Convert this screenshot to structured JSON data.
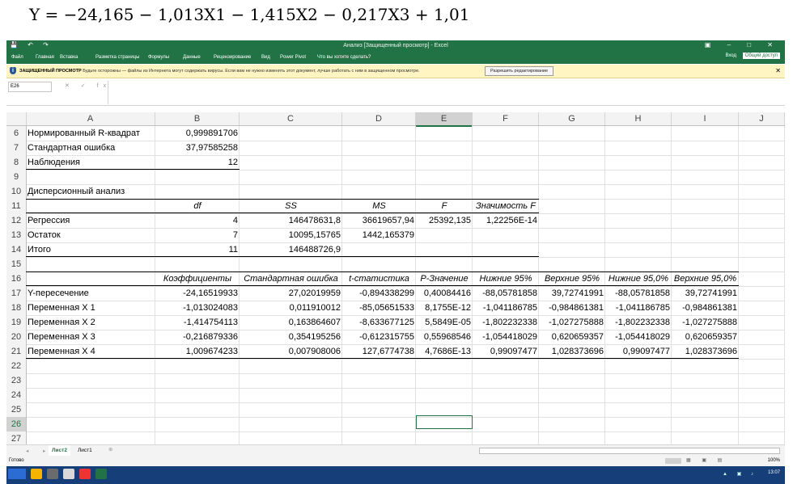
{
  "formula": "Y = −24,165 − 1,013X1 − 1,415X2 − 0,217X3 + 1,01",
  "window": {
    "quick_access": "💾 ↶ ↷",
    "title": "Анализ [Защищенный просмотр] - Excel",
    "controls": "▣ – □ ✕"
  },
  "ribbon": {
    "tabs": [
      "Файл",
      "Главная",
      "Вставка",
      "Разметка страницы",
      "Формулы",
      "Данные",
      "Рецензирование",
      "Вид",
      "Power Pivot",
      "Что вы хотите сделать?"
    ],
    "signin": "Вход",
    "share": "Общий доступ"
  },
  "protected_bar": {
    "label": "ЗАЩИЩЕННЫЙ ПРОСМОТР",
    "message": "Будьте осторожны — файлы из Интернета могут содержать вирусы. Если вам не нужно изменять этот документ, лучше работать с ним в защищенном просмотре.",
    "button": "Разрешить редактирование"
  },
  "formula_bar": {
    "name_box": "E26",
    "icons": "✕ ✓ fx",
    "value": ""
  },
  "columns": [
    "A",
    "B",
    "C",
    "D",
    "E",
    "F",
    "G",
    "H",
    "I",
    "J"
  ],
  "rows": [
    {
      "n": "6",
      "A": "Нормированный R-квадрат",
      "B": "0,999891706"
    },
    {
      "n": "7",
      "A": "Стандартная ошибка",
      "B": "37,97585258"
    },
    {
      "n": "8",
      "A": "Наблюдения",
      "B": "12"
    },
    {
      "n": "9"
    },
    {
      "n": "10",
      "A": "Дисперсионный анализ"
    },
    {
      "n": "11",
      "B": "df",
      "C": "SS",
      "D": "MS",
      "E": "F",
      "F": "Значимость F"
    },
    {
      "n": "12",
      "A": "Регрессия",
      "B": "4",
      "C": "146478631,8",
      "D": "36619657,94",
      "E": "25392,135",
      "F": "1,22256E-14"
    },
    {
      "n": "13",
      "A": "Остаток",
      "B": "7",
      "C": "10095,15765",
      "D": "1442,165379"
    },
    {
      "n": "14",
      "A": "Итого",
      "B": "11",
      "C": "146488726,9"
    },
    {
      "n": "15"
    },
    {
      "n": "16",
      "B": "Коэффициенты",
      "C": "Стандартная ошибка",
      "D": "t-статистика",
      "E": "P-Значение",
      "F": "Нижние 95%",
      "G": "Верхние 95%",
      "H": "Нижние 95,0%",
      "I": "Верхние 95,0%"
    },
    {
      "n": "17",
      "A": "Y-пересечение",
      "B": "-24,16519933",
      "C": "27,02019959",
      "D": "-0,894338299",
      "E": "0,40084416",
      "F": "-88,05781858",
      "G": "39,72741991",
      "H": "-88,05781858",
      "I": "39,72741991"
    },
    {
      "n": "18",
      "A": "Переменная X 1",
      "B": "-1,013024083",
      "C": "0,011910012",
      "D": "-85,05651533",
      "E": "8,1755E-12",
      "F": "-1,041186785",
      "G": "-0,984861381",
      "H": "-1,041186785",
      "I": "-0,984861381"
    },
    {
      "n": "19",
      "A": "Переменная X 2",
      "B": "-1,414754113",
      "C": "0,163864607",
      "D": "-8,633677125",
      "E": "5,5849E-05",
      "F": "-1,802232338",
      "G": "-1,027275888",
      "H": "-1,802232338",
      "I": "-1,027275888"
    },
    {
      "n": "20",
      "A": "Переменная X 3",
      "B": "-0,216879336",
      "C": "0,354195256",
      "D": "-0,612315755",
      "E": "0,55968546",
      "F": "-1,054418029",
      "G": "0,620659357",
      "H": "-1,054418029",
      "I": "0,620659357"
    },
    {
      "n": "21",
      "A": "Переменная X 4",
      "B": "1,009674233",
      "C": "0,007908006",
      "D": "127,6774738",
      "E": "4,7686E-13",
      "F": "0,99097477",
      "G": "1,028373696",
      "H": "0,99097477",
      "I": "1,028373696"
    },
    {
      "n": "22"
    },
    {
      "n": "23"
    },
    {
      "n": "24"
    },
    {
      "n": "25"
    },
    {
      "n": "26"
    },
    {
      "n": "27"
    }
  ],
  "sheets": [
    "Лист2",
    "Лист1"
  ],
  "sheet_nav": "◂ ▸",
  "add_sheet": "⊕",
  "status": {
    "ready": "Готово",
    "zoom": "100%",
    "views": "▦ ▣ ▤"
  },
  "taskbar": {
    "tray": "▲ ▣ ♪",
    "clock": "13:07"
  }
}
